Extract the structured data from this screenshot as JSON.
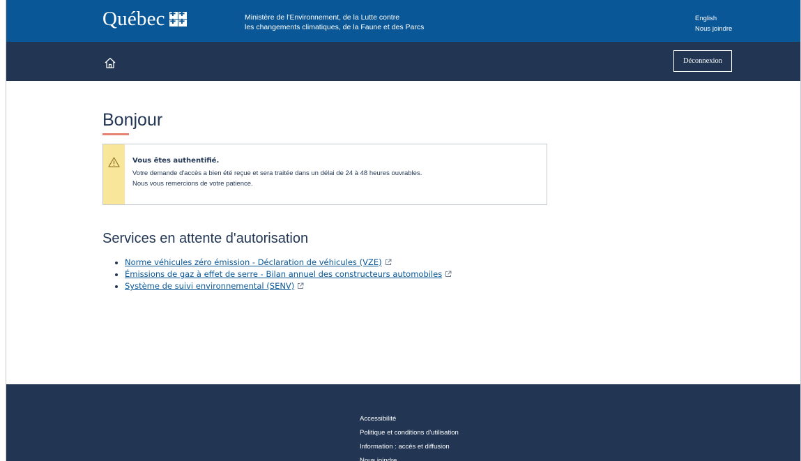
{
  "header": {
    "logo_text": "Québec",
    "ministry_line1": "Ministère de l'Environnement, de la Lutte contre",
    "ministry_line2": "les changements climatiques, de la Faune et des Parcs",
    "links": [
      "English",
      "Nous joindre"
    ]
  },
  "nav": {
    "home_icon": "home-icon",
    "logout_label": "Déconnexion"
  },
  "main": {
    "greeting": "Bonjour",
    "alert": {
      "icon": "warning-icon",
      "title": "Vous êtes authentifié.",
      "line1": "Votre demande d'accès a bien été reçue et sera traitée dans un délai de 24 à 48 heures ouvrables.",
      "line2": "Nous vous remercions de votre patience."
    },
    "section_title": "Services en attente d'autorisation",
    "services": [
      "Norme véhicules zéro émission - Déclaration de véhicules (VZE)",
      "Émissions de gaz à effet de serre - Bilan annuel des constructeurs automobiles",
      "Système de suivi environnemental (SENV)"
    ]
  },
  "footer": {
    "links": [
      "Accessibilité",
      "Politique et conditions d'utilisation",
      "Information : accès et diffusion",
      "Nous joindre"
    ]
  },
  "colors": {
    "header_blue": "#095797",
    "navy": "#223654",
    "accent_underline": "#e58271",
    "alert_yellow": "#f8e69a"
  }
}
